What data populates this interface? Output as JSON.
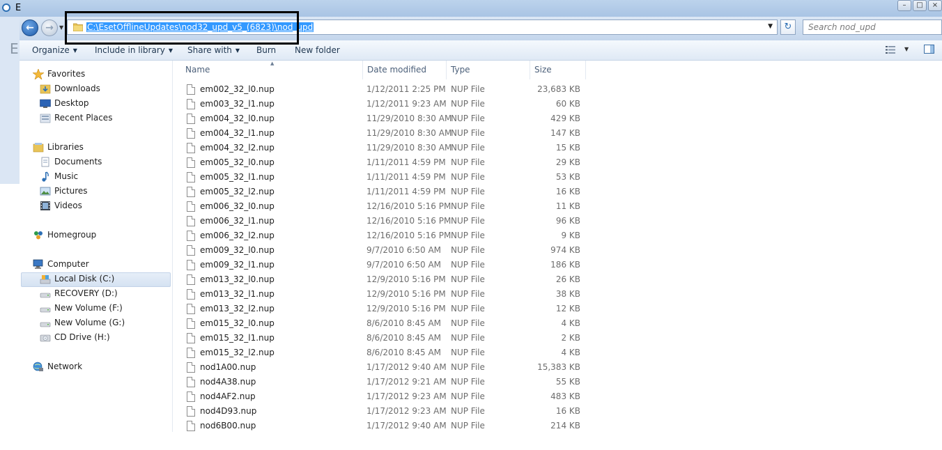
{
  "window": {
    "title_char": "E",
    "behind_letter": "E"
  },
  "address_bar": {
    "path": "C:\\EsetOfflineUpdates\\nod32_upd_v5_(6823)\\nod_upd"
  },
  "search": {
    "placeholder": "Search nod_upd"
  },
  "toolbar": {
    "organize": "Organize",
    "include_in_library": "Include in library",
    "share_with": "Share with",
    "burn": "Burn",
    "new_folder": "New folder"
  },
  "nav_pane": {
    "favorites": "Favorites",
    "downloads": "Downloads",
    "desktop": "Desktop",
    "recent_places": "Recent Places",
    "libraries": "Libraries",
    "documents": "Documents",
    "music": "Music",
    "pictures": "Pictures",
    "videos": "Videos",
    "homegroup": "Homegroup",
    "computer": "Computer",
    "local_disk": "Local Disk (C:)",
    "recovery": "RECOVERY (D:)",
    "new_volume_f": "New Volume (F:)",
    "new_volume_g": "New Volume (G:)",
    "cd_drive": "CD Drive (H:)",
    "network": "Network"
  },
  "columns": {
    "name": "Name",
    "date_modified": "Date modified",
    "type": "Type",
    "size": "Size"
  },
  "files": [
    {
      "name": "em002_32_l0.nup",
      "date": "1/12/2011 2:25 PM",
      "type": "NUP File",
      "size": "23,683 KB"
    },
    {
      "name": "em003_32_l1.nup",
      "date": "1/12/2011 9:23 AM",
      "type": "NUP File",
      "size": "60 KB"
    },
    {
      "name": "em004_32_l0.nup",
      "date": "11/29/2010 8:30 AM",
      "type": "NUP File",
      "size": "429 KB"
    },
    {
      "name": "em004_32_l1.nup",
      "date": "11/29/2010 8:30 AM",
      "type": "NUP File",
      "size": "147 KB"
    },
    {
      "name": "em004_32_l2.nup",
      "date": "11/29/2010 8:30 AM",
      "type": "NUP File",
      "size": "15 KB"
    },
    {
      "name": "em005_32_l0.nup",
      "date": "1/11/2011 4:59 PM",
      "type": "NUP File",
      "size": "29 KB"
    },
    {
      "name": "em005_32_l1.nup",
      "date": "1/11/2011 4:59 PM",
      "type": "NUP File",
      "size": "53 KB"
    },
    {
      "name": "em005_32_l2.nup",
      "date": "1/11/2011 4:59 PM",
      "type": "NUP File",
      "size": "16 KB"
    },
    {
      "name": "em006_32_l0.nup",
      "date": "12/16/2010 5:16 PM",
      "type": "NUP File",
      "size": "11 KB"
    },
    {
      "name": "em006_32_l1.nup",
      "date": "12/16/2010 5:16 PM",
      "type": "NUP File",
      "size": "96 KB"
    },
    {
      "name": "em006_32_l2.nup",
      "date": "12/16/2010 5:16 PM",
      "type": "NUP File",
      "size": "9 KB"
    },
    {
      "name": "em009_32_l0.nup",
      "date": "9/7/2010 6:50 AM",
      "type": "NUP File",
      "size": "974 KB"
    },
    {
      "name": "em009_32_l1.nup",
      "date": "9/7/2010 6:50 AM",
      "type": "NUP File",
      "size": "186 KB"
    },
    {
      "name": "em013_32_l0.nup",
      "date": "12/9/2010 5:16 PM",
      "type": "NUP File",
      "size": "26 KB"
    },
    {
      "name": "em013_32_l1.nup",
      "date": "12/9/2010 5:16 PM",
      "type": "NUP File",
      "size": "38 KB"
    },
    {
      "name": "em013_32_l2.nup",
      "date": "12/9/2010 5:16 PM",
      "type": "NUP File",
      "size": "12 KB"
    },
    {
      "name": "em015_32_l0.nup",
      "date": "8/6/2010 8:45 AM",
      "type": "NUP File",
      "size": "4 KB"
    },
    {
      "name": "em015_32_l1.nup",
      "date": "8/6/2010 8:45 AM",
      "type": "NUP File",
      "size": "2 KB"
    },
    {
      "name": "em015_32_l2.nup",
      "date": "8/6/2010 8:45 AM",
      "type": "NUP File",
      "size": "4 KB"
    },
    {
      "name": "nod1A00.nup",
      "date": "1/17/2012 9:40 AM",
      "type": "NUP File",
      "size": "15,383 KB"
    },
    {
      "name": "nod4A38.nup",
      "date": "1/17/2012 9:21 AM",
      "type": "NUP File",
      "size": "55 KB"
    },
    {
      "name": "nod4AF2.nup",
      "date": "1/17/2012 9:23 AM",
      "type": "NUP File",
      "size": "483 KB"
    },
    {
      "name": "nod4D93.nup",
      "date": "1/17/2012 9:23 AM",
      "type": "NUP File",
      "size": "16 KB"
    },
    {
      "name": "nod6B00.nup",
      "date": "1/17/2012 9:40 AM",
      "type": "NUP File",
      "size": "214 KB"
    }
  ]
}
